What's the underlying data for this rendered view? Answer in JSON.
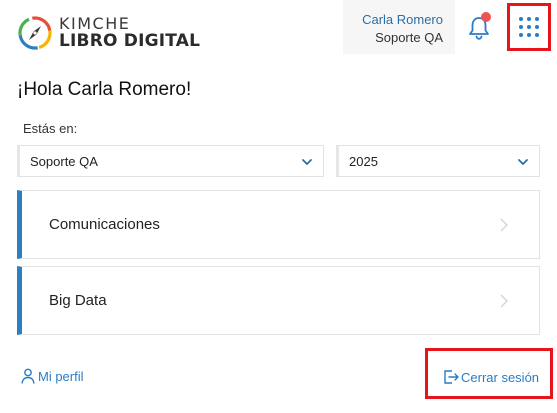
{
  "brand": {
    "top": "KIMCHE",
    "bottom": "LIBRO DIGITAL"
  },
  "user": {
    "name": "Carla Romero",
    "org": "Soporte QA"
  },
  "greeting": "¡Hola Carla Romero!",
  "location_label": "Estás en:",
  "selects": {
    "organization": "Soporte QA",
    "year": "2025"
  },
  "cards": [
    {
      "label": "Comunicaciones"
    },
    {
      "label": "Big Data"
    }
  ],
  "footer": {
    "profile": "Mi perfil",
    "logout": "Cerrar sesión"
  },
  "colors": {
    "accent": "#2e7fbf",
    "link": "#2a7cc7",
    "notification": "#ef5350",
    "highlight": "#e8141b"
  }
}
